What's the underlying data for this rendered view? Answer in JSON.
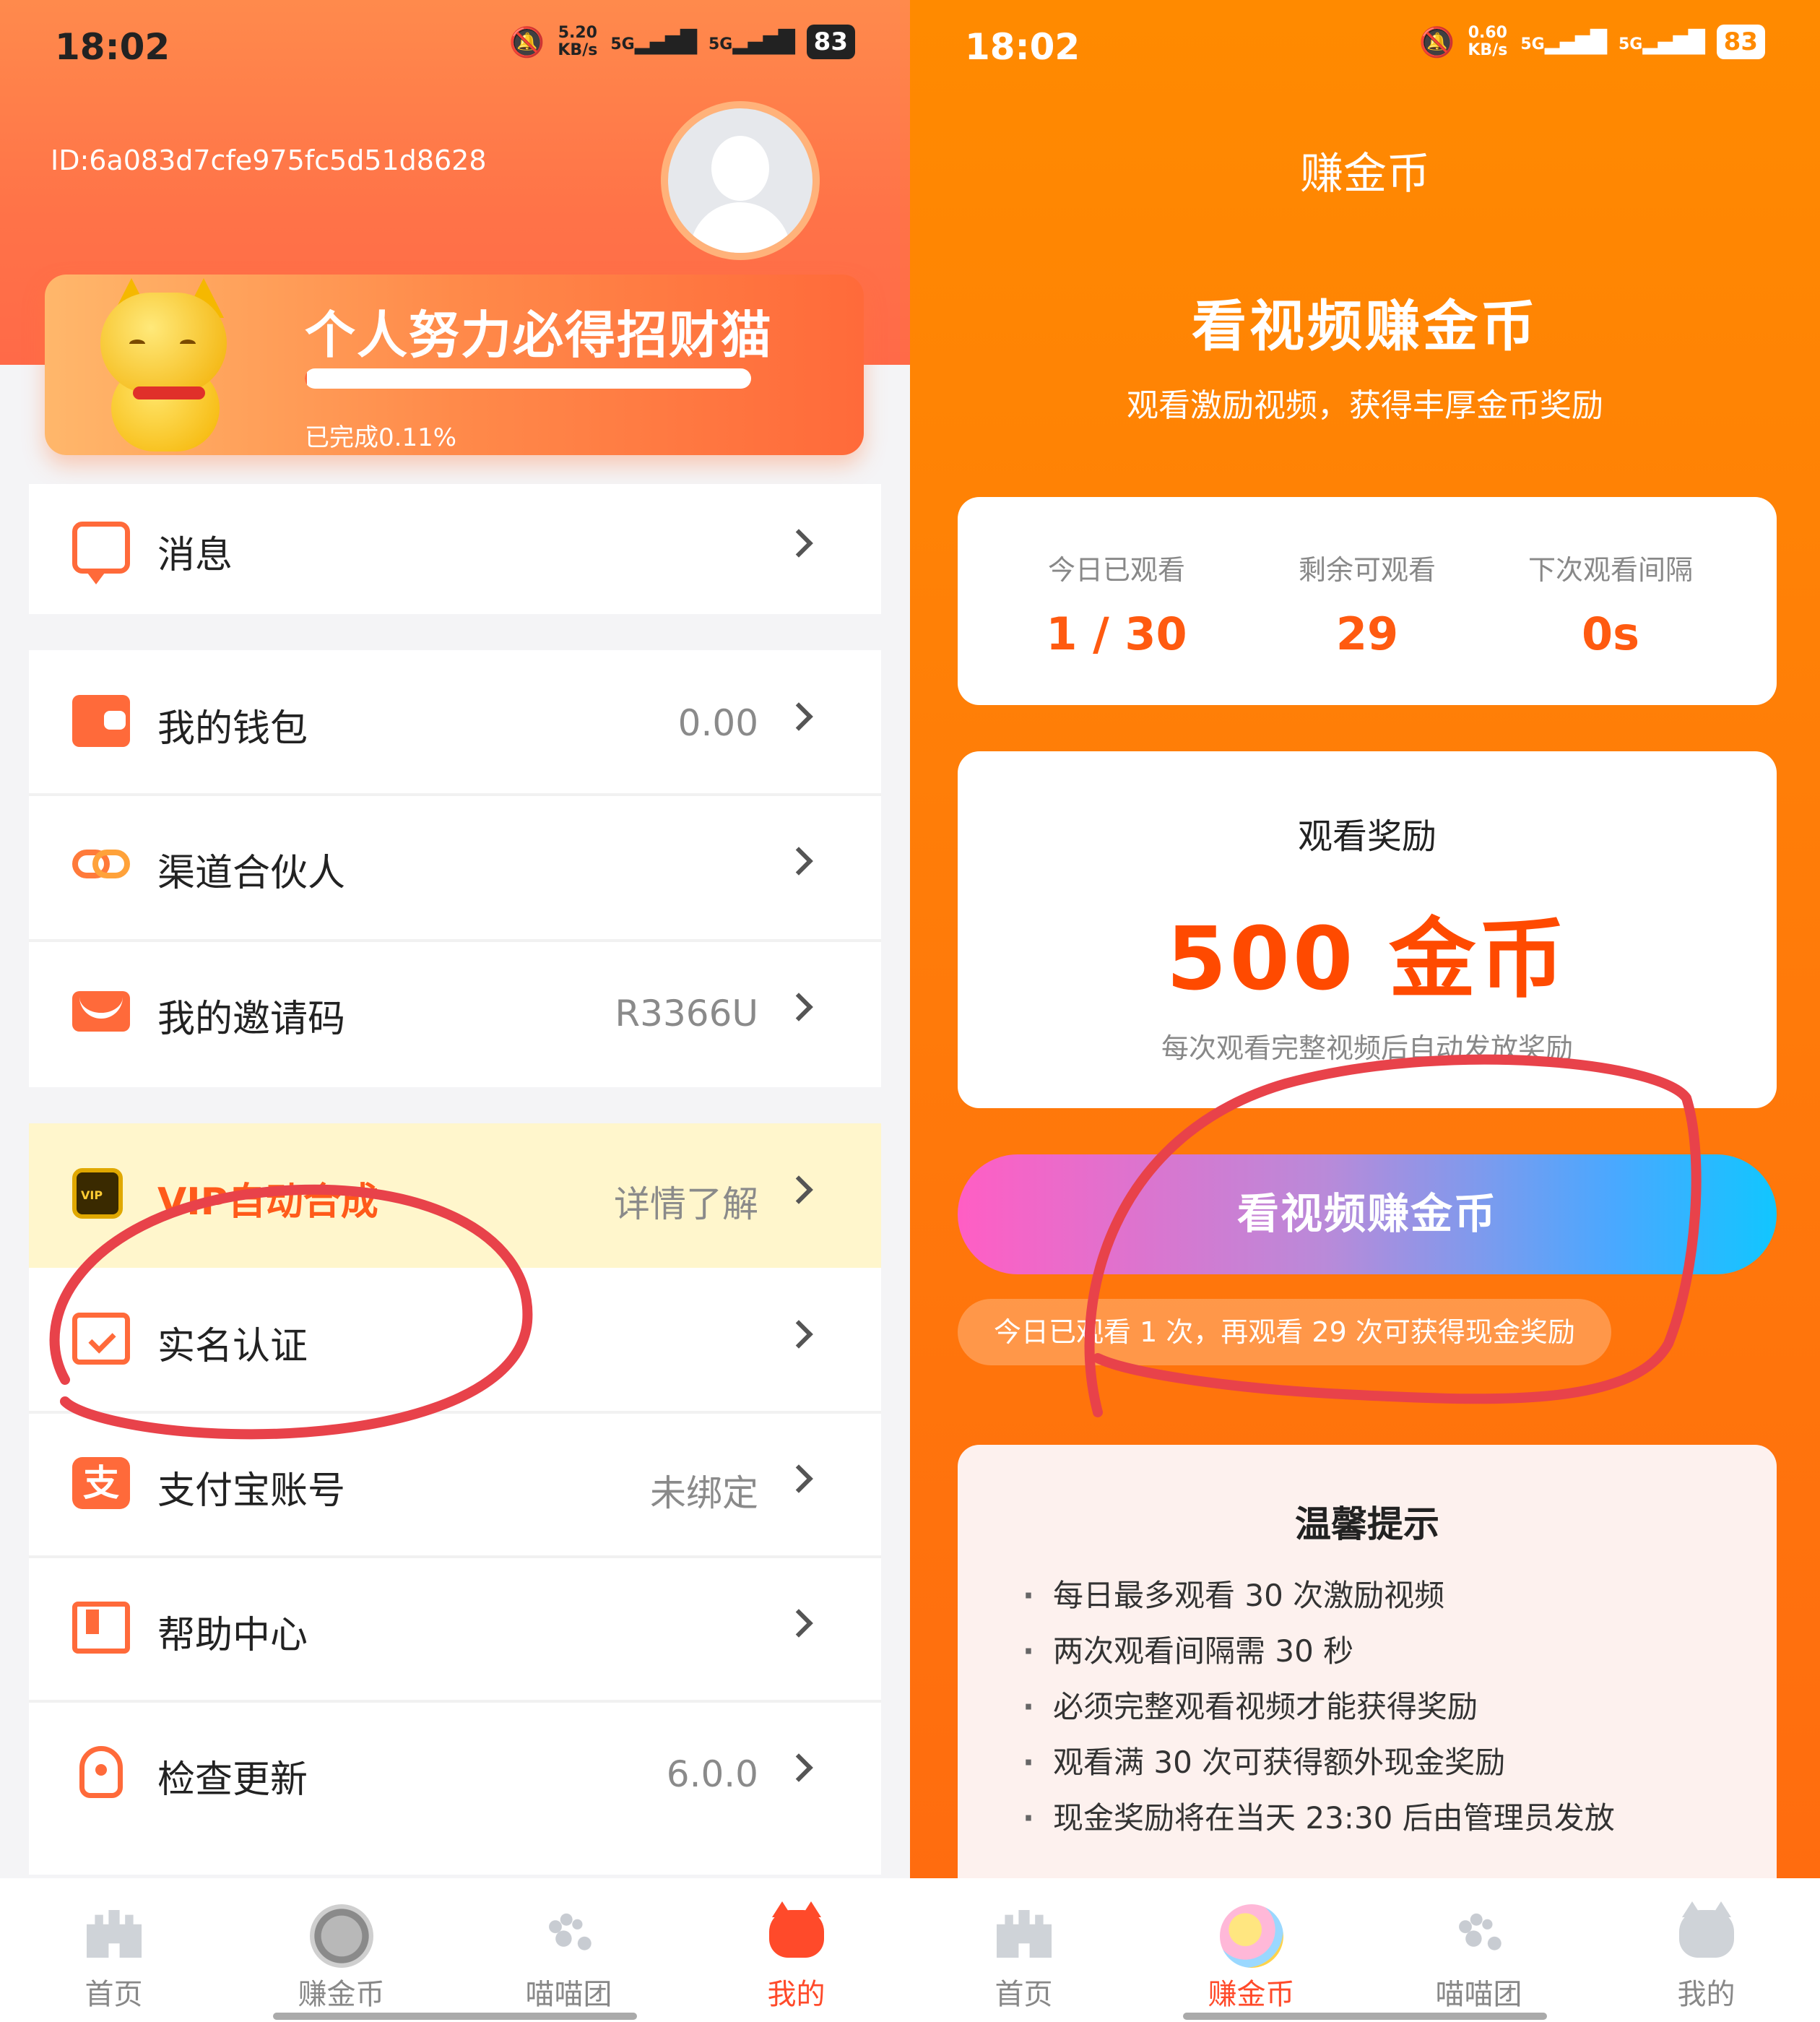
{
  "left": {
    "status": {
      "time": "18:02",
      "speed_value": "5.20",
      "speed_unit": "KB/s",
      "net1": "5G",
      "net2": "5G",
      "battery": "83"
    },
    "user_id": "ID:6a083d7cfe975fc5d51d8628",
    "banner": {
      "title": "个人努力必得招财猫",
      "progress_text": "已完成0.11%",
      "progress_fraction": 0.0011
    },
    "menu": {
      "messages": {
        "label": "消息",
        "icon": "chat-icon"
      },
      "wallet": {
        "label": "我的钱包",
        "value": "0.00",
        "icon": "wallet-icon"
      },
      "partner": {
        "label": "渠道合伙人",
        "icon": "link-icon"
      },
      "invite": {
        "label": "我的邀请码",
        "value": "R3366U",
        "icon": "envelope-icon"
      },
      "vip": {
        "label": "VIP自动合成",
        "value": "详情了解",
        "icon": "vip-crown-icon"
      },
      "realname": {
        "label": "实名认证",
        "icon": "id-check-icon"
      },
      "alipay": {
        "label": "支付宝账号",
        "value": "未绑定",
        "icon": "alipay-icon",
        "icon_char": "支"
      },
      "help": {
        "label": "帮助中心",
        "icon": "book-icon"
      },
      "update": {
        "label": "检查更新",
        "value": "6.0.0",
        "icon": "rocket-icon"
      }
    },
    "tabs": [
      {
        "label": "首页",
        "icon": "castle-icon"
      },
      {
        "label": "赚金币",
        "icon": "coin-icon"
      },
      {
        "label": "喵喵团",
        "icon": "paw-icon"
      },
      {
        "label": "我的",
        "icon": "cat-face-icon"
      }
    ]
  },
  "right": {
    "status": {
      "time": "18:02",
      "speed_value": "0.60",
      "speed_unit": "KB/s",
      "net1": "5G",
      "net2": "5G",
      "battery": "83"
    },
    "title": "赚金币",
    "hero": "看视频赚金币",
    "subtitle": "观看激励视频，获得丰厚金币奖励",
    "stats": [
      {
        "label": "今日已观看",
        "value": "1 / 30"
      },
      {
        "label": "剩余可观看",
        "value": "29"
      },
      {
        "label": "下次观看间隔",
        "value": "0s"
      }
    ],
    "reward": {
      "label": "观看奖励",
      "value": "500 金币",
      "note": "每次观看完整视频后自动发放奖励"
    },
    "watch_button": "看视频赚金币",
    "progress_note": "今日已观看 1 次，再观看 29 次可获得现金奖励",
    "tips": {
      "title": "温馨提示",
      "items": [
        "每日最多观看 30 次激励视频",
        "两次观看间隔需 30 秒",
        "必须完整观看视频才能获得奖励",
        "观看满 30 次可获得额外现金奖励",
        "现金奖励将在当天 23:30 后由管理员发放"
      ]
    },
    "tabs": [
      {
        "label": "首页",
        "icon": "castle-icon"
      },
      {
        "label": "赚金币",
        "icon": "coin-icon"
      },
      {
        "label": "喵喵团",
        "icon": "paw-icon"
      },
      {
        "label": "我的",
        "icon": "cat-face-icon"
      }
    ]
  },
  "colors": {
    "accent_orange": "#ff6a3a",
    "active_tab": "#ff4a2a",
    "annotation_red": "#e8424a",
    "reward_orange": "#ff4a00"
  }
}
